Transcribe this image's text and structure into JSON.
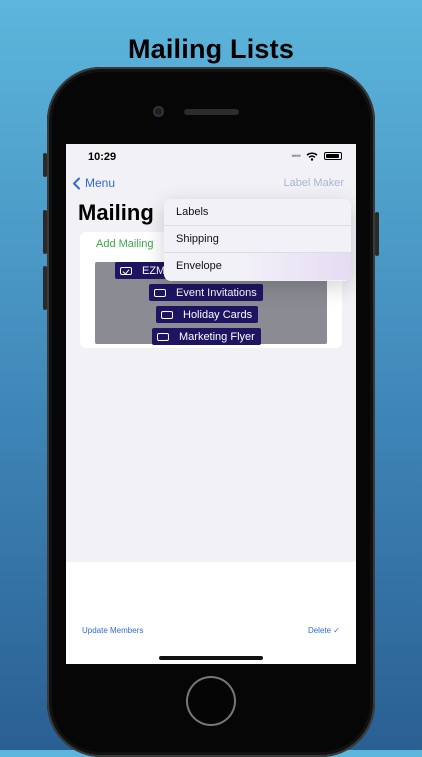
{
  "promo": {
    "title": "Mailing Lists"
  },
  "status_bar": {
    "time": "10:29"
  },
  "nav": {
    "back_label": "Menu",
    "right_label": "Label Maker"
  },
  "page": {
    "title": "Mailing"
  },
  "card": {
    "add_label": "Add Mailing"
  },
  "mailing_lists": [
    {
      "label": "EZM",
      "checked": true
    },
    {
      "label": "Event Invitations",
      "checked": false
    },
    {
      "label": "Holiday Cards",
      "checked": false
    },
    {
      "label": "Marketing Flyer",
      "checked": false
    }
  ],
  "popup_menu": {
    "items": [
      "Labels",
      "Shipping",
      "Envelope"
    ]
  },
  "bottom_bar": {
    "left_label": "Update Members",
    "right_label": "Delete ✓"
  },
  "colors": {
    "accent": "#2f6bd9",
    "add": "#3ba84a",
    "chip": "#1d1562",
    "background_top": "#5cb6dc"
  },
  "icons": {
    "back": "chevron-left-icon",
    "wifi": "wifi-icon",
    "battery": "battery-icon",
    "checkbox": "checkbox-icon"
  }
}
